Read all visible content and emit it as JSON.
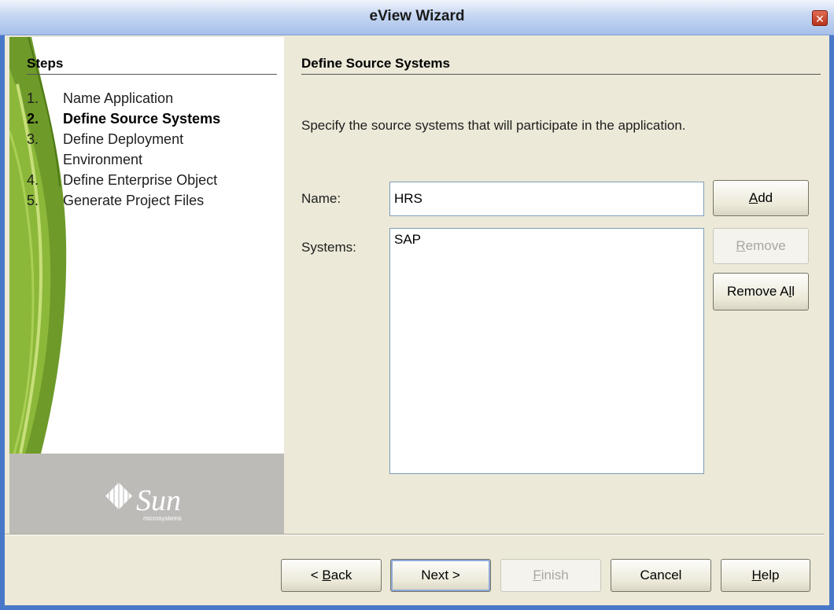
{
  "window": {
    "title": "eView Wizard",
    "close_glyph": "✕"
  },
  "steps": {
    "header": "Steps",
    "items": [
      {
        "num": "1.",
        "label": "Name Application",
        "active": false
      },
      {
        "num": "2.",
        "label": "Define Source Systems",
        "active": true
      },
      {
        "num": "3.",
        "label": "Define Deployment",
        "label2": "Environment",
        "active": false
      },
      {
        "num": "4.",
        "label": "Define Enterprise Object",
        "active": false
      },
      {
        "num": "5.",
        "label": "Generate Project Files",
        "active": false
      }
    ]
  },
  "branding": {
    "logo_word": "Sun",
    "logo_sub": "microsystems"
  },
  "page": {
    "header": "Define Source Systems",
    "instructions": "Specify the source systems that will participate in the application."
  },
  "form": {
    "name_label": "Name:",
    "name_value": "HRS",
    "systems_label": "Systems:",
    "systems": [
      "SAP"
    ],
    "add_pre": "",
    "add_key": "A",
    "add_post": "dd",
    "remove_pre": "",
    "remove_key": "R",
    "remove_post": "emove",
    "remove_all_pre": "Remove A",
    "remove_all_key": "l",
    "remove_all_post": "l"
  },
  "footer": {
    "back_pre": "< ",
    "back_key": "B",
    "back_post": "ack",
    "next_label": "Next >",
    "finish_pre": "",
    "finish_key": "F",
    "finish_post": "inish",
    "cancel_label": "Cancel",
    "help_pre": "",
    "help_key": "H",
    "help_post": "elp"
  },
  "colors": {
    "title_gradient_top": "#f0f4fb",
    "title_gradient_bottom": "#a7c0ea",
    "window_border": "#4a78c8",
    "dialog_bg": "#ece9d8",
    "disabled_text": "#a8a7a0"
  },
  "icons": {
    "close": "close-icon",
    "logo": "sun-logo-icon",
    "decoration": "leaf-decoration"
  }
}
